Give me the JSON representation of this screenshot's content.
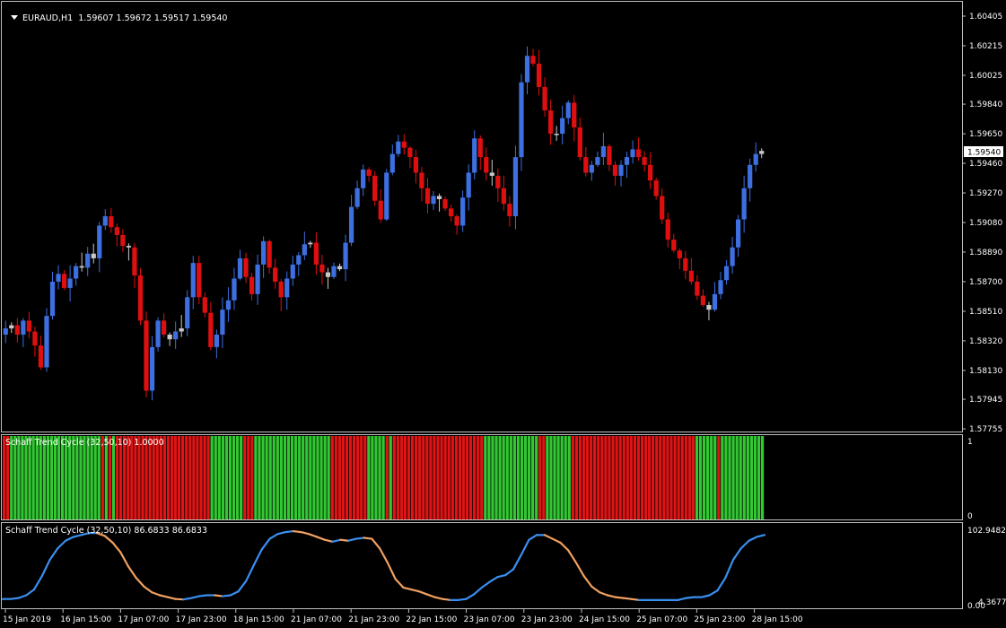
{
  "header": {
    "symbol": "EURAUD,H1",
    "ohlc": "1.59607 1.59672 1.59517 1.59540"
  },
  "panes": {
    "stc_histogram": {
      "label": "Schaff Trend Cycle (32,50,10) 1.0000",
      "ticks": [
        "1",
        "0"
      ]
    },
    "stc_line": {
      "label": "Schaff Trend Cycle (32,50,10) 86.6833 86.6833",
      "ticks": [
        "102.9482",
        "4.3677",
        "0.00"
      ]
    }
  },
  "colors": {
    "background": "#000000",
    "border": "#c0c0c0",
    "bull": "#3d6fe0",
    "bear": "#e00f0f",
    "neutral": "#c8c8c8",
    "hist_bull": "#32c832",
    "hist_bear": "#e01414",
    "line_up": "#3a8ff0",
    "line_down": "#f0a060"
  },
  "chart_data": {
    "type": "candlestick",
    "symbol": "EURAUD,H1",
    "price_ticks": [
      "1.60405",
      "1.60215",
      "1.60025",
      "1.59840",
      "1.59650",
      "1.59460",
      "1.59270",
      "1.59080",
      "1.58890",
      "1.58700",
      "1.58510",
      "1.58320",
      "1.58130",
      "1.57945",
      "1.57755"
    ],
    "price_range": [
      1.57755,
      1.60405
    ],
    "current_price": "1.59540",
    "time_labels": [
      "15 Jan 2019",
      "16 Jan 15:00",
      "17 Jan 07:00",
      "17 Jan 23:00",
      "18 Jan 15:00",
      "21 Jan 07:00",
      "21 Jan 23:00",
      "22 Jan 15:00",
      "23 Jan 07:00",
      "23 Jan 23:00",
      "24 Jan 15:00",
      "25 Jan 07:00",
      "25 Jan 23:00",
      "28 Jan 15:00"
    ],
    "closes": [
      1.584,
      1.5842,
      1.5836,
      1.5845,
      1.5838,
      1.5829,
      1.5815,
      1.5848,
      1.587,
      1.5875,
      1.5866,
      1.5872,
      1.588,
      1.5879,
      1.5888,
      1.5885,
      1.5906,
      1.5912,
      1.5905,
      1.59,
      1.5893,
      1.5892,
      1.5874,
      1.5845,
      1.58,
      1.5828,
      1.5845,
      1.5836,
      1.5833,
      1.5838,
      1.584,
      1.586,
      1.5882,
      1.586,
      1.585,
      1.5828,
      1.5836,
      1.5852,
      1.5858,
      1.5872,
      1.5885,
      1.5873,
      1.5862,
      1.5881,
      1.5896,
      1.5879,
      1.587,
      1.586,
      1.5872,
      1.5881,
      1.5887,
      1.5894,
      1.5895,
      1.5881,
      1.5876,
      1.5873,
      1.588,
      1.5878,
      1.5895,
      1.5918,
      1.593,
      1.5942,
      1.5938,
      1.5922,
      1.591,
      1.594,
      1.5952,
      1.596,
      1.5956,
      1.595,
      1.594,
      1.593,
      1.592,
      1.5925,
      1.5923,
      1.5917,
      1.5912,
      1.5906,
      1.5924,
      1.594,
      1.5962,
      1.595,
      1.594,
      1.5938,
      1.593,
      1.592,
      1.5912,
      1.595,
      1.5998,
      1.6015,
      1.601,
      1.5995,
      1.598,
      1.5965,
      1.5965,
      1.5975,
      1.5985,
      1.5969,
      1.595,
      1.594,
      1.5945,
      1.595,
      1.5957,
      1.5945,
      1.5938,
      1.5945,
      1.595,
      1.5955,
      1.595,
      1.5945,
      1.5935,
      1.5925,
      1.591,
      1.5897,
      1.589,
      1.5885,
      1.5877,
      1.587,
      1.5861,
      1.5855,
      1.5852,
      1.5862,
      1.5871,
      1.588,
      1.5892,
      1.591,
      1.593,
      1.5945,
      1.5952,
      1.5954
    ]
  },
  "stc_series": {
    "hist_states": [
      "red",
      "red",
      "green",
      "green",
      "green",
      "green",
      "green",
      "green",
      "green",
      "green",
      "green",
      "green",
      "green",
      "green",
      "green",
      "green",
      "green",
      "green",
      "green",
      "green",
      "green",
      "green",
      "green",
      "green",
      "green",
      "green",
      "green",
      "red",
      "green",
      "red",
      "green",
      "red",
      "red",
      "red",
      "red",
      "red",
      "red",
      "red",
      "red",
      "red",
      "red",
      "red",
      "red",
      "red",
      "red",
      "red",
      "red",
      "red",
      "red",
      "red",
      "red",
      "red",
      "red",
      "red",
      "red",
      "red",
      "red",
      "green",
      "green",
      "green",
      "green",
      "green",
      "green",
      "green",
      "green",
      "green",
      "red",
      "red",
      "red",
      "green",
      "green",
      "green",
      "green",
      "green",
      "green",
      "green",
      "green",
      "green",
      "green",
      "green",
      "green",
      "green",
      "green",
      "green",
      "green",
      "green",
      "green",
      "green",
      "green",
      "green",
      "red",
      "red",
      "red",
      "red",
      "red",
      "red",
      "red",
      "red",
      "red",
      "red",
      "green",
      "green",
      "green",
      "green",
      "green",
      "red",
      "green",
      "red",
      "red",
      "red",
      "red",
      "red",
      "red",
      "red",
      "red",
      "red",
      "red",
      "red",
      "red",
      "red",
      "red",
      "red",
      "red",
      "red",
      "red",
      "red",
      "red",
      "red",
      "red",
      "red",
      "red",
      "red",
      "green",
      "green",
      "green",
      "green",
      "green",
      "green",
      "green",
      "green",
      "green",
      "green",
      "green",
      "green",
      "green",
      "green",
      "green",
      "red",
      "red",
      "green",
      "green",
      "green",
      "green",
      "green",
      "green",
      "green",
      "red",
      "red",
      "red",
      "red",
      "red",
      "red",
      "red",
      "red",
      "red",
      "red",
      "red",
      "red",
      "red",
      "red",
      "red",
      "red",
      "red",
      "red",
      "red",
      "red",
      "red",
      "red",
      "red",
      "red",
      "red",
      "red",
      "red",
      "red",
      "red",
      "red",
      "red",
      "red",
      "red",
      "red",
      "green",
      "green",
      "green",
      "green",
      "green",
      "green",
      "red",
      "green",
      "green",
      "green",
      "green",
      "green",
      "green",
      "green",
      "green",
      "green",
      "green",
      "green",
      "green"
    ],
    "line_values": [
      5.3,
      5.3,
      6.6,
      10.5,
      18.4,
      36.8,
      59.2,
      75.0,
      85.5,
      90.7,
      93.4,
      96.1,
      96.1,
      92.1,
      82.9,
      69.7,
      50.0,
      34.2,
      22.4,
      14.5,
      10.5,
      7.9,
      5.3,
      4.7,
      6.6,
      9.2,
      10.5,
      10.5,
      9.2,
      10.5,
      15.8,
      30.3,
      52.6,
      73.7,
      88.2,
      94.7,
      97.4,
      98.7,
      97.4,
      94.7,
      90.8,
      86.8,
      84.2,
      86.8,
      85.5,
      88.2,
      89.5,
      88.2,
      75.0,
      55.3,
      32.9,
      21.1,
      18.4,
      15.8,
      11.8,
      7.9,
      5.3,
      3.9,
      3.9,
      5.3,
      11.8,
      21.1,
      28.9,
      35.5,
      38.2,
      46.1,
      65.8,
      86.8,
      93.4,
      93.4,
      88.2,
      82.9,
      72.4,
      55.3,
      36.8,
      22.4,
      14.5,
      10.5,
      7.9,
      6.6,
      5.3,
      3.9,
      3.9,
      3.9,
      3.9,
      3.9,
      3.9,
      6.6,
      7.9,
      7.9,
      10.5,
      17.1,
      34.2,
      59.2,
      75.0,
      85.5,
      90.8,
      93.4
    ]
  }
}
